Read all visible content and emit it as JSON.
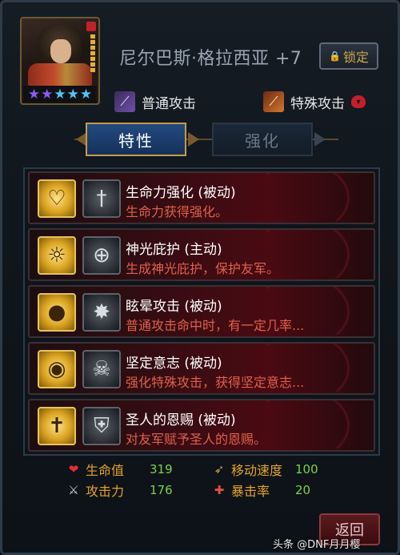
{
  "hero": {
    "name": "尼尔巴斯·格拉西亚 +7",
    "stars": [
      {
        "icon": "star-purple-icon",
        "glyph": "★"
      },
      {
        "icon": "star-purple-icon",
        "glyph": "★"
      },
      {
        "icon": "star-blue-icon",
        "glyph": "★"
      },
      {
        "icon": "star-blue-icon",
        "glyph": "★"
      },
      {
        "icon": "star-blue-icon",
        "glyph": "★"
      }
    ],
    "lock_label": "锁定"
  },
  "attacks": {
    "normal_label": "普通攻击",
    "special_label": "特殊攻击"
  },
  "tabs": [
    {
      "label": "特性",
      "active": true
    },
    {
      "label": "强化",
      "active": false
    }
  ],
  "skills": [
    {
      "title": "生命力强化 (被动)",
      "desc": "生命力获得强化。",
      "icon": "heart-figure-icon",
      "icon2": "sword-icon"
    },
    {
      "title": "神光庇护 (主动)",
      "desc": "生成神光庇护，保护友军。",
      "icon": "light-shield-icon",
      "icon2": "crosshair-icon"
    },
    {
      "title": "眩晕攻击 (被动)",
      "desc": "普通攻击命中时，有一定几率...",
      "icon": "stun-figure-icon",
      "icon2": "burst-icon"
    },
    {
      "title": "坚定意志 (被动)",
      "desc": "强化特殊攻击，获得坚定意志...",
      "icon": "will-icon",
      "icon2": "skull-icon"
    },
    {
      "title": "圣人的恩赐 (被动)",
      "desc": "对友军赋予圣人的恩赐。",
      "icon": "holy-cross-icon",
      "icon2": "emblem-icon"
    }
  ],
  "stats": {
    "hp": {
      "label": "生命值",
      "value": "319"
    },
    "attack": {
      "label": "攻击力",
      "value": "176"
    },
    "speed": {
      "label": "移动速度",
      "value": "100"
    },
    "crit": {
      "label": "暴击率",
      "value": "20"
    }
  },
  "return_label": "返回",
  "watermark": "头条 @DNF月月樱",
  "colors": {
    "skill_desc": "#e0604c",
    "stat_label": "#e2a22a",
    "stat_value": "#7bd04a",
    "tab_active": "#234a80",
    "tab_border": "#c69b4a"
  }
}
